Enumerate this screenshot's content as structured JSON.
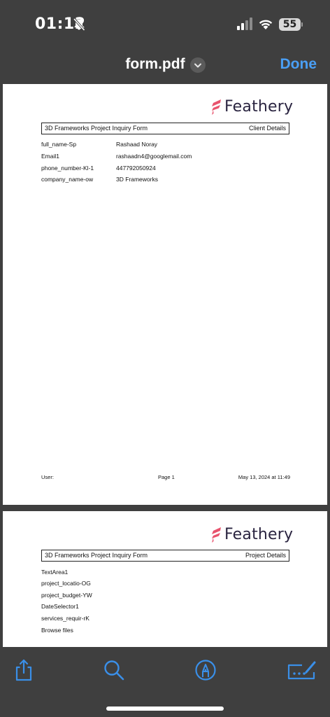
{
  "status_bar": {
    "time": "01:12",
    "battery": "55"
  },
  "nav": {
    "title": "form.pdf",
    "done_label": "Done"
  },
  "colors": {
    "accent": "#4a9ff5",
    "brand": "#e8536d"
  },
  "logo_text": "Feathery",
  "page1": {
    "form_title": "3D Frameworks Project Inquiry Form",
    "section": "Client Details",
    "fields": [
      {
        "label": "full_name-Sp",
        "value": "Rashaad Noray"
      },
      {
        "label": "Email1",
        "value": "rashaadn4@googlemail.com"
      },
      {
        "label": "phone_number-Kl-1",
        "value": "447792050924"
      },
      {
        "label": "company_name-ow",
        "value": "3D Frameworks"
      }
    ],
    "footer": {
      "user": "User:",
      "page": "Page 1",
      "date": "May 13, 2024 at 11:49"
    }
  },
  "page2": {
    "form_title": "3D Frameworks Project Inquiry Form",
    "section": "Project Details",
    "fields": [
      {
        "label": "TextArea1"
      },
      {
        "label": "project_locatio-OG"
      },
      {
        "label": "project_budget-YW"
      },
      {
        "label": "DateSelector1"
      },
      {
        "label": "services_requir-rK"
      },
      {
        "label": "Browse files"
      }
    ]
  },
  "toolbar": {
    "icons": [
      "share-icon",
      "search-icon",
      "markup-icon",
      "signature-icon"
    ]
  }
}
